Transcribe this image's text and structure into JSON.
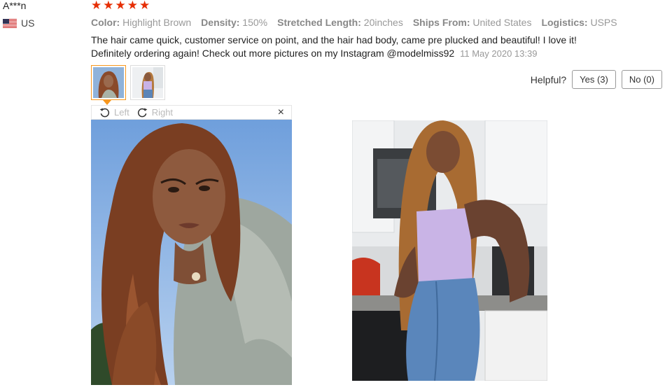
{
  "review": {
    "reviewer": "A***n",
    "country": "US",
    "flag_icon": "us-flag-icon",
    "rating": 5,
    "stars": [
      "★",
      "★",
      "★",
      "★",
      "★"
    ],
    "properties": [
      {
        "label": "Color:",
        "value": "Highlight Brown"
      },
      {
        "label": "Density:",
        "value": "150%"
      },
      {
        "label": "Stretched Length:",
        "value": "20inches"
      },
      {
        "label": "Ships From:",
        "value": "United States"
      },
      {
        "label": "Logistics:",
        "value": "USPS"
      }
    ],
    "text": "The hair came quick, customer service on point, and the hair had body, came pre plucked and beautiful! I love it! Definitely ordering again! Check out more pictures on my Instagram @modelmiss92",
    "date": "11 May 2020 13:39"
  },
  "helpful": {
    "label": "Helpful?",
    "yes_label": "Yes (3)",
    "no_label": "No (0)"
  },
  "viewer": {
    "rotate_left": "Left",
    "rotate_right": "Right",
    "close": "×",
    "icons": [
      "rotate-left-icon",
      "rotate-right-icon",
      "close-icon"
    ]
  },
  "colors": {
    "star": "#e62e04",
    "active_thumb": "#f7971e"
  }
}
